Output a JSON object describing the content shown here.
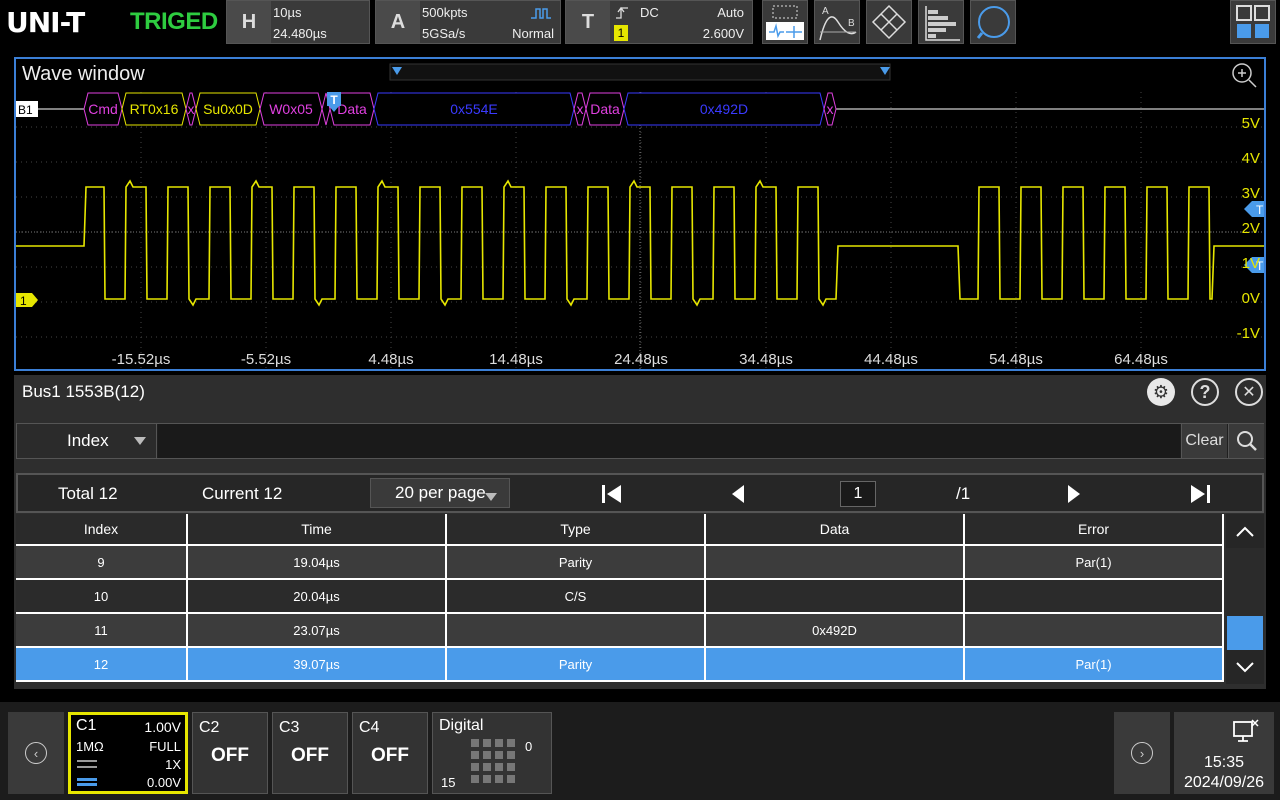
{
  "brand": {
    "logo": "UNI-T",
    "status": "TRIGED"
  },
  "horizontal": {
    "letter": "H",
    "scale": "10µs",
    "offset": "24.480µs"
  },
  "acquire": {
    "letter": "A",
    "depth": "500kpts",
    "rate": "5GSa/s",
    "mode": "Normal"
  },
  "trigger": {
    "letter": "T",
    "coupling": "DC",
    "sweep": "Auto",
    "source": "1",
    "level": "2.600V"
  },
  "toolbar_icons": [
    "measure-select-icon",
    "cursor-ab-icon",
    "math-diamond-icon",
    "histogram-icon",
    "search-zoom-icon",
    "layout-grid-icon"
  ],
  "wave": {
    "title": "Wave window",
    "bus_label": "B1",
    "ch_marker": "1",
    "trig_marker": "T",
    "th_label": "TH",
    "tl_label": "TL",
    "decode": [
      {
        "text": "Cmd",
        "color": "#e040e0"
      },
      {
        "text": "RT0x16",
        "color": "#e6e600"
      },
      {
        "text": "x",
        "color": "#e040e0"
      },
      {
        "text": "Su0x0D",
        "color": "#e6e600"
      },
      {
        "text": "W0x05",
        "color": "#e040e0"
      },
      {
        "text": "Data",
        "color": "#e040e0"
      },
      {
        "text": "0x554E",
        "color": "#3a3aff"
      },
      {
        "text": "x",
        "color": "#e040e0"
      },
      {
        "text": "Data",
        "color": "#e040e0"
      },
      {
        "text": "0x492D",
        "color": "#3a3aff"
      },
      {
        "text": "x",
        "color": "#e040e0"
      }
    ],
    "volt_labels": [
      "5V",
      "4V",
      "3V",
      "2V",
      "1V",
      "0V",
      "-1V"
    ],
    "time_labels": [
      "-15.52µs",
      "-5.52µs",
      "4.48µs",
      "14.48µs",
      "24.48µs",
      "34.48µs",
      "44.48µs",
      "54.48µs",
      "64.48µs"
    ],
    "trace_color": "#e6e600"
  },
  "bus": {
    "title": "Bus1 1553B(12)",
    "search_field": "Index",
    "search_value": "",
    "clear_label": "Clear",
    "total": "Total 12",
    "current": "Current 12",
    "per_page": "20 per page",
    "page": "1",
    "pages": "/1",
    "columns": [
      "Index",
      "Time",
      "Type",
      "Data",
      "Error"
    ],
    "rows": [
      {
        "index": "9",
        "time": "19.04µs",
        "type": "Parity",
        "data": "",
        "error": "Par(1)"
      },
      {
        "index": "10",
        "time": "20.04µs",
        "type": "C/S",
        "data": "",
        "error": ""
      },
      {
        "index": "11",
        "time": "23.07µs",
        "type": "",
        "data": "0x492D",
        "error": ""
      },
      {
        "index": "12",
        "time": "39.07µs",
        "type": "Parity",
        "data": "",
        "error": "Par(1)"
      }
    ],
    "selected_index": "12",
    "selected_color": "#4a9bea"
  },
  "channels": {
    "c1": {
      "name": "C1",
      "scale": "1.00V",
      "impedance": "1MΩ",
      "bw": "FULL",
      "probe": "1X",
      "offset": "0.00V",
      "color": "#e6e600"
    },
    "c2": {
      "name": "C2",
      "state": "OFF"
    },
    "c3": {
      "name": "C3",
      "state": "OFF"
    },
    "c4": {
      "name": "C4",
      "state": "OFF"
    },
    "digital": {
      "name": "Digital",
      "low": "0",
      "high": "15"
    }
  },
  "clock": {
    "time": "15:35",
    "date": "2024/09/26"
  }
}
